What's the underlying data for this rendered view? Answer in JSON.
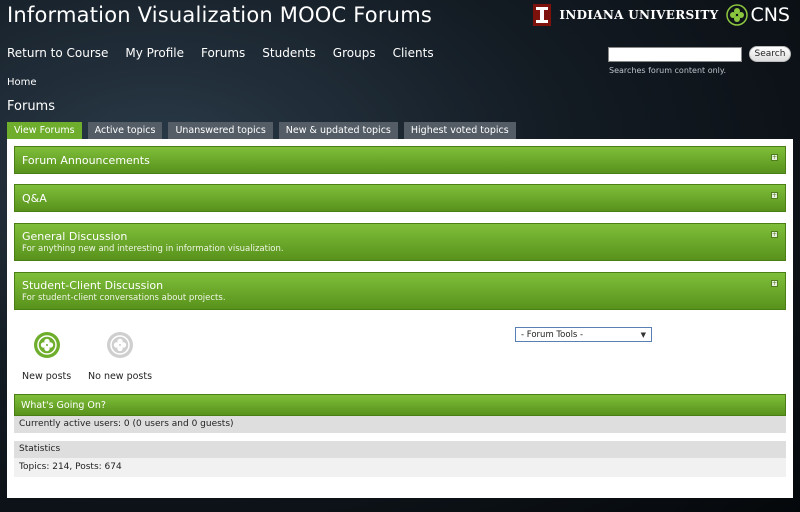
{
  "site": {
    "title": "Information Visualization MOOC Forums"
  },
  "brand": {
    "university": "INDIANA UNIVERSITY",
    "lab": "CNS"
  },
  "nav": [
    "Return to Course",
    "My Profile",
    "Forums",
    "Students",
    "Groups",
    "Clients"
  ],
  "search": {
    "value": "",
    "button": "Search",
    "hint": "Searches forum content only."
  },
  "breadcrumb": "Home",
  "page_title": "Forums",
  "tabs": [
    {
      "label": "View Forums",
      "active": true
    },
    {
      "label": "Active topics",
      "active": false
    },
    {
      "label": "Unanswered topics",
      "active": false
    },
    {
      "label": "New & updated topics",
      "active": false
    },
    {
      "label": "Highest voted topics",
      "active": false
    }
  ],
  "forums": [
    {
      "title": "Forum Announcements",
      "desc": ""
    },
    {
      "title": "Q&A",
      "desc": ""
    },
    {
      "title": "General Discussion",
      "desc": "For anything new and interesting in information visualization."
    },
    {
      "title": "Student-Client Discussion",
      "desc": "For student-client conversations about projects."
    }
  ],
  "legend": {
    "new_posts": "New posts",
    "no_new_posts": "No new posts"
  },
  "forum_tools": "- Forum Tools -",
  "whats_going_on": {
    "heading": "What's Going On?",
    "active_users": "Currently active users: 0 (0 users and 0 guests)",
    "stats_heading": "Statistics",
    "stats": "Topics: 214, Posts: 674"
  },
  "colors": {
    "accent_green": "#6fae2c",
    "tab_grey": "#545d66"
  }
}
